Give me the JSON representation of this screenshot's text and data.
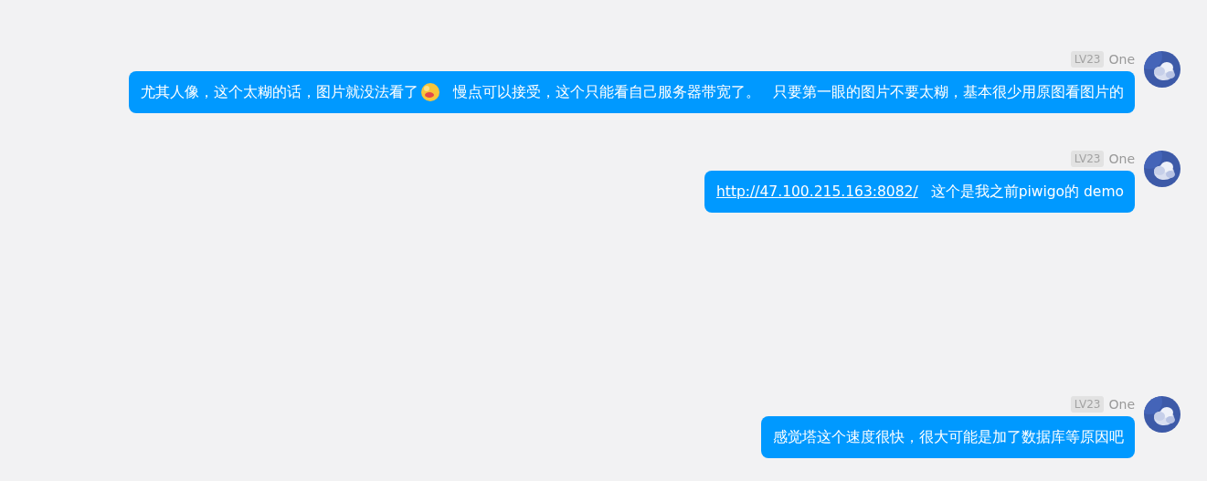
{
  "messages": [
    {
      "level_badge": "LV23",
      "sender": "One",
      "avatar": {
        "kind": "picture"
      },
      "segments": [
        {
          "kind": "text",
          "text": "尤其人像，这个太糊的话，图片就没法看了"
        },
        {
          "kind": "emoji"
        },
        {
          "kind": "text",
          "text": "慢点可以接受，这个只能看自己服务器带宽了。"
        },
        {
          "kind": "text",
          "text": "只要第一眼的图片不要太糊，基本很少用原图看图片的"
        }
      ]
    },
    {
      "level_badge": "LV23",
      "sender": "One",
      "avatar": {
        "kind": "picture"
      },
      "segments": [
        {
          "kind": "link",
          "text": "http://47.100.215.163:8082/"
        },
        {
          "kind": "text",
          "text": "这个是我之前piwigo的 demo"
        }
      ]
    },
    {
      "level_badge": "LV23",
      "sender": "One",
      "avatar": {
        "kind": "picture"
      },
      "segments": [
        {
          "kind": "text",
          "text": "感觉塔这个速度很快，很大可能是加了数据库等原因吧"
        }
      ]
    }
  ]
}
